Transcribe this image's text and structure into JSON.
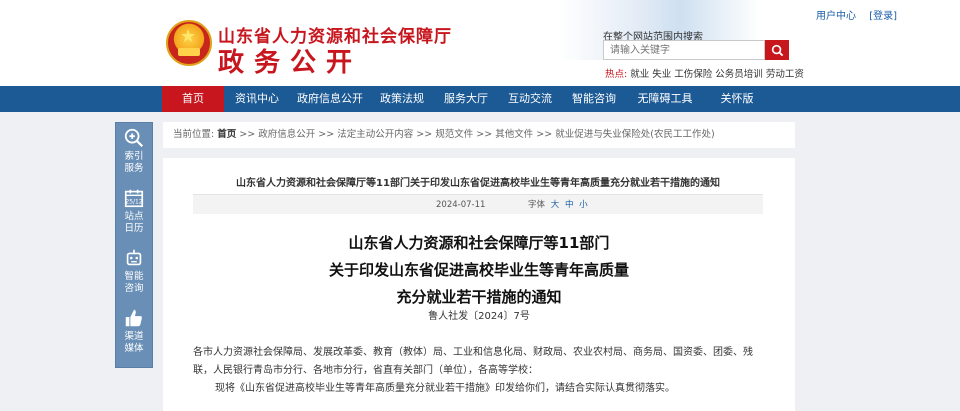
{
  "header": {
    "dept_name": "山东省人力资源和社会保障厅",
    "site_name": "政务公开",
    "top_links": [
      "用户中心",
      "[登录]"
    ],
    "search_hint": "在整个网站范围内搜索",
    "search_placeholder": "请输入关键字",
    "hot_label": "热点:",
    "hot_items": "就业 失业 工伤保险 公务员培训 劳动工资"
  },
  "nav": {
    "items": [
      "首页",
      "资讯中心",
      "政府信息公开",
      "政策法规",
      "服务大厅",
      "互动交流",
      "智能咨询",
      "无障碍工具",
      "关怀版"
    ],
    "active_index": 0
  },
  "sidebar": {
    "items": [
      {
        "label_1": "索引",
        "label_2": "服务",
        "icon": "search-plus-icon"
      },
      {
        "label_1": "站点",
        "label_2": "日历",
        "icon": "calendar-icon",
        "icon_text": "25/12"
      },
      {
        "label_1": "智能",
        "label_2": "咨询",
        "icon": "robot-icon"
      },
      {
        "label_1": "渠道",
        "label_2": "媒体",
        "icon": "thumbs-up-icon"
      }
    ]
  },
  "breadcrumb": {
    "prefix": "当前位置:",
    "items": [
      "首页",
      "政府信息公开",
      "法定主动公开内容",
      "规范文件",
      "其他文件",
      "就业促进与失业保险处(农民工工作处)"
    ],
    "separator": ">>"
  },
  "article": {
    "strip_title": "山东省人力资源和社会保障厅等11部门关于印发山东省促进高校毕业生等青年高质量充分就业若干措施的通知",
    "date": "2024-07-11",
    "font_label": "字体",
    "font_sizes": [
      "大",
      "中",
      "小"
    ],
    "title_lines": [
      "山东省人力资源和社会保障厅等11部门",
      "关于印发山东省促进高校毕业生等青年高质量",
      "充分就业若干措施的通知"
    ],
    "doc_no": "鲁人社发〔2024〕7号",
    "recipients_1": "各市人力资源社会保障局、发展改革委、教育（教体）局、工业和信息化局、财政局、农业农村局、商务局、国资委、团委、残",
    "recipients_2": "联，人民银行青岛市分行、各地市分行，省直有关部门（单位），各高等学校：",
    "paragraph_1": "现将《山东省促进高校毕业生等青年高质量充分就业若干措施》印发给你们，请结合实际认真贯彻落实。"
  },
  "colors": {
    "brand_red": "#c7161d",
    "nav_blue": "#1c5a95",
    "sidebar_blue": "#6a8fb6",
    "link_blue": "#1a5ea8"
  }
}
